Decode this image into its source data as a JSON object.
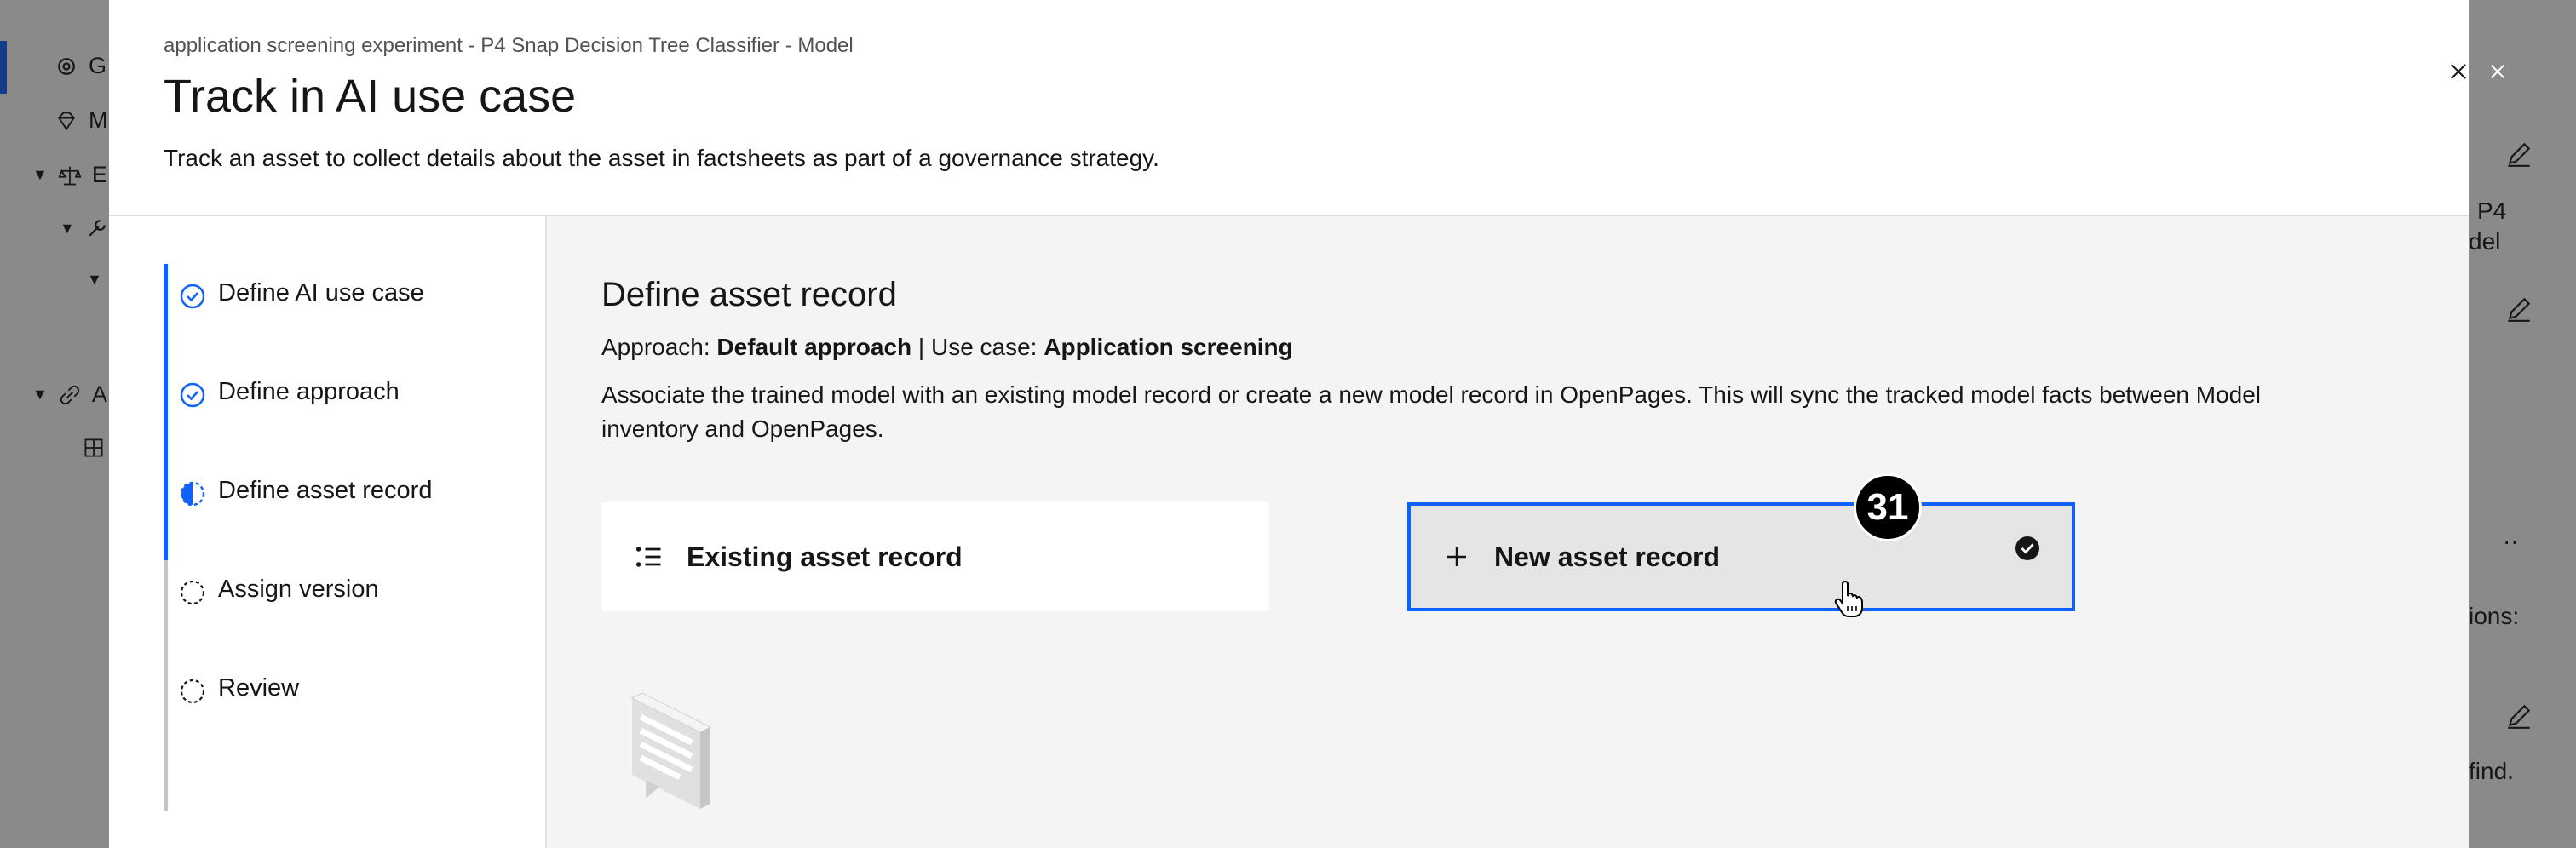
{
  "background": {
    "left_items": [
      {
        "glyph": "G"
      },
      {
        "glyph": "M"
      },
      {
        "glyph": "E"
      },
      {
        "glyph": ""
      },
      {
        "glyph": "A"
      }
    ],
    "right_fragments": [
      "P4",
      "del",
      "ions:",
      "find."
    ]
  },
  "modal": {
    "subtitle": "application screening experiment - P4 Snap Decision Tree Classifier - Model",
    "title": "Track in AI use case",
    "description": "Track an asset to collect details about the asset in factsheets as part of a governance strategy.",
    "steps": [
      {
        "label": "Define AI use case",
        "state": "complete"
      },
      {
        "label": "Define approach",
        "state": "complete"
      },
      {
        "label": "Define asset record",
        "state": "current"
      },
      {
        "label": "Assign version",
        "state": "incomplete"
      },
      {
        "label": "Review",
        "state": "incomplete"
      }
    ],
    "content": {
      "section_title": "Define asset record",
      "approach_label": "Approach:",
      "approach_value": "Default approach",
      "separator": "|",
      "use_case_label": "Use case:",
      "use_case_value": "Application screening",
      "association_text": "Associate the trained model with an existing model record or create a new model record in OpenPages. This will sync the tracked model facts between Model inventory and OpenPages.",
      "tiles": [
        {
          "label": "Existing asset record",
          "icon": "list-icon",
          "selected": false
        },
        {
          "label": "New asset record",
          "icon": "add-icon",
          "selected": true
        }
      ]
    },
    "step_badge": "31"
  },
  "colors": {
    "accent": "#0f62fe",
    "overlay": "rgba(22,22,22,0.5)",
    "content_bg": "#f4f4f4"
  }
}
